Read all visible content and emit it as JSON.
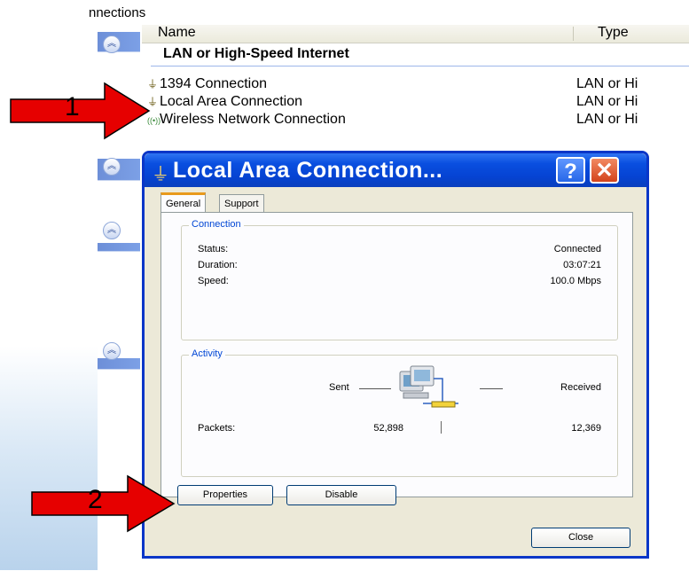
{
  "explorer": {
    "title_fragment": "nnections",
    "columns": {
      "name": "Name",
      "type": "Type"
    },
    "group_title": "LAN or High-Speed Internet",
    "items": [
      {
        "name": "1394 Connection",
        "type": "LAN or Hi",
        "icon": "network-plug-icon"
      },
      {
        "name": "Local Area Connection",
        "type": "LAN or Hi",
        "icon": "network-plug-icon"
      },
      {
        "name": "Wireless Network Connection",
        "type": "LAN or Hi",
        "icon": "wireless-icon"
      }
    ]
  },
  "annotations": {
    "arrow1_label": "1",
    "arrow2_label": "2",
    "arrow_color": "#e60000"
  },
  "dialog": {
    "title": "Local Area Connection...",
    "help_label": "?",
    "close_x_label": "✕",
    "tabs": [
      "General",
      "Support"
    ],
    "active_tab": "General",
    "connection": {
      "legend": "Connection",
      "status_label": "Status:",
      "status_value": "Connected",
      "duration_label": "Duration:",
      "duration_value": "03:07:21",
      "speed_label": "Speed:",
      "speed_value": "100.0 Mbps"
    },
    "activity": {
      "legend": "Activity",
      "sent_label": "Sent",
      "received_label": "Received",
      "packets_label": "Packets:",
      "packets_sent": "52,898",
      "packets_received": "12,369"
    },
    "buttons": {
      "properties": "Properties",
      "disable": "Disable",
      "close": "Close"
    },
    "colors": {
      "titlebar": "#0543d2",
      "frame": "#0a36c8",
      "face": "#ece9d8",
      "close_button": "#d3431b"
    }
  }
}
